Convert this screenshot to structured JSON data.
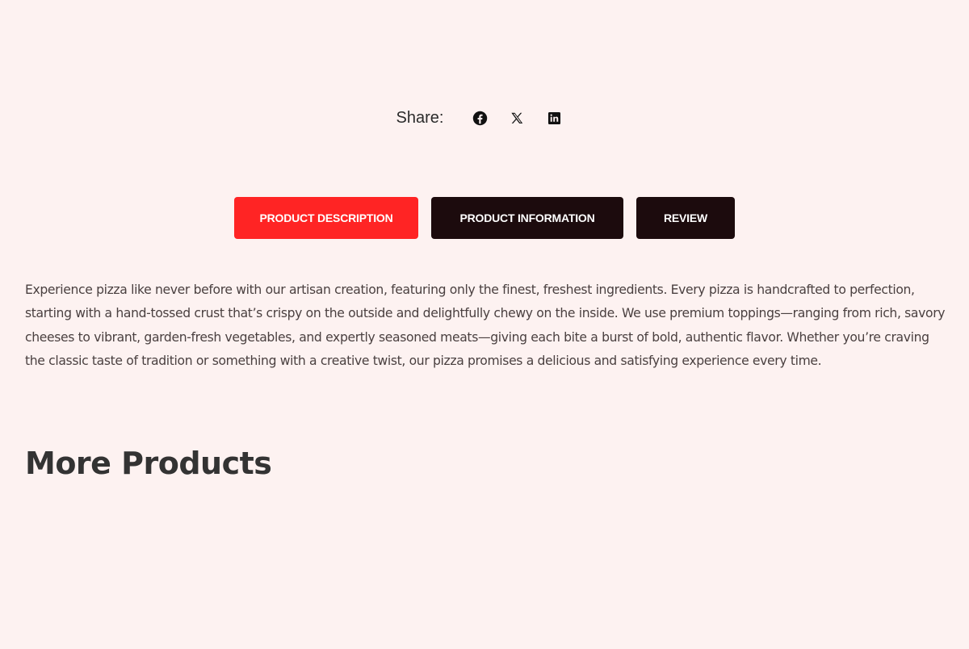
{
  "share": {
    "label": "Share:",
    "icons": [
      "facebook-icon",
      "x-twitter-icon",
      "linkedin-icon"
    ]
  },
  "tabs": [
    {
      "label": "PRODUCT DESCRIPTION",
      "active": true,
      "color": "#ff2424"
    },
    {
      "label": "PRODUCT INFORMATION",
      "active": false,
      "color": "#1c0b0d"
    },
    {
      "label": "REVIEW",
      "active": false,
      "color": "#1c0b0d"
    }
  ],
  "description": "Experience pizza like never before with our artisan creation, featuring only the finest, freshest ingredients. Every pizza is handcrafted to perfection, starting with a hand-tossed crust that’s crispy on the outside and delightfully chewy on the inside. We use premium toppings—ranging from rich, savory cheeses to vibrant, garden-fresh vegetables, and expertly seasoned meats—giving each bite a burst of bold, authentic flavor. Whether you’re craving the classic taste of tradition or something with a creative twist, our pizza promises a delicious and satisfying experience every time.",
  "more_products": {
    "heading": "More Products"
  },
  "colors": {
    "background": "#fdf2f1",
    "accent": "#ff2424",
    "dark": "#1c0b0d"
  }
}
